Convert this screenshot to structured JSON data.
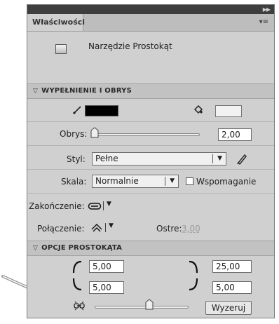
{
  "panel": {
    "tab_title": "Właściwości",
    "tool_name": "Narzędzie Prostokąt"
  },
  "fill_stroke": {
    "header": "WYPEŁNIENIE I OBRYS",
    "stroke_color": "#000000",
    "fill_color": "#ffffff",
    "stroke_label": "Obrys:",
    "stroke_value": "2,00",
    "stroke_slider_level": 0,
    "style_label": "Styl:",
    "style_value": "Pełne",
    "scale_label": "Skala:",
    "scale_value": "Normalnie",
    "hinting_label": "Wspomaganie",
    "hinting_checked": false,
    "cap_label": "Zakończenie:",
    "join_label": "Połączenie:",
    "miter_label": "Ostre:",
    "miter_value": "3,00"
  },
  "rect_options": {
    "header": "OPCJE PROSTOKĄTA",
    "top_left": "5,00",
    "top_right": "25,00",
    "bottom_left": "5,00",
    "bottom_right": "5,00",
    "reset_label": "Wyzeruj",
    "radius_slider_level": 0.5
  },
  "icons": {
    "expand": "double-chevron-right-icon",
    "menu": "panel-menu-icon",
    "tool": "rectangle-tool-icon",
    "stroke": "pencil-icon",
    "fill": "paint-bucket-icon",
    "edit_style": "pencil-icon",
    "cap": "cap-icon",
    "join": "join-icon",
    "lock": "link-lock-icon",
    "pointer": "arrow-pointer"
  }
}
